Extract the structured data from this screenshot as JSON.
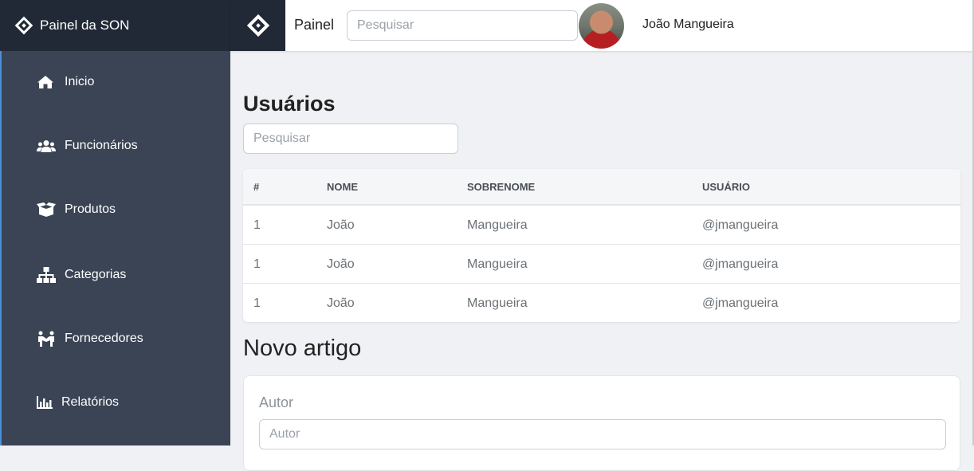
{
  "brand": {
    "title": "Painel da SON"
  },
  "sidebar": {
    "items": [
      {
        "label": "Inicio",
        "icon": "home-icon"
      },
      {
        "label": "Funcionários",
        "icon": "users-icon"
      },
      {
        "label": "Produtos",
        "icon": "box-icon"
      },
      {
        "label": "Categorias",
        "icon": "sitemap-icon"
      },
      {
        "label": "Fornecedores",
        "icon": "handshake-icon"
      },
      {
        "label": "Relatórios",
        "icon": "bar-chart-icon"
      }
    ]
  },
  "topbar": {
    "title": "Painel",
    "search_placeholder": "Pesquisar",
    "user_name": "João Mangueira"
  },
  "main": {
    "title": "Usuários",
    "search_placeholder": "Pesquisar",
    "table": {
      "columns": [
        "#",
        "NOME",
        "SOBRENOME",
        "USUÁRIO"
      ],
      "rows": [
        [
          "1",
          "João",
          "Mangueira",
          "@jmangueira"
        ],
        [
          "1",
          "João",
          "Mangueira",
          "@jmangueira"
        ],
        [
          "1",
          "João",
          "Mangueira",
          "@jmangueira"
        ]
      ]
    },
    "form": {
      "title": "Novo artigo",
      "author_label": "Autor",
      "author_placeholder": "Autor"
    }
  },
  "colors": {
    "sidebar_dark": "#212936",
    "sidebar": "#3a4454",
    "background": "#f0f1f4",
    "accent_border": "#4a90d9"
  }
}
